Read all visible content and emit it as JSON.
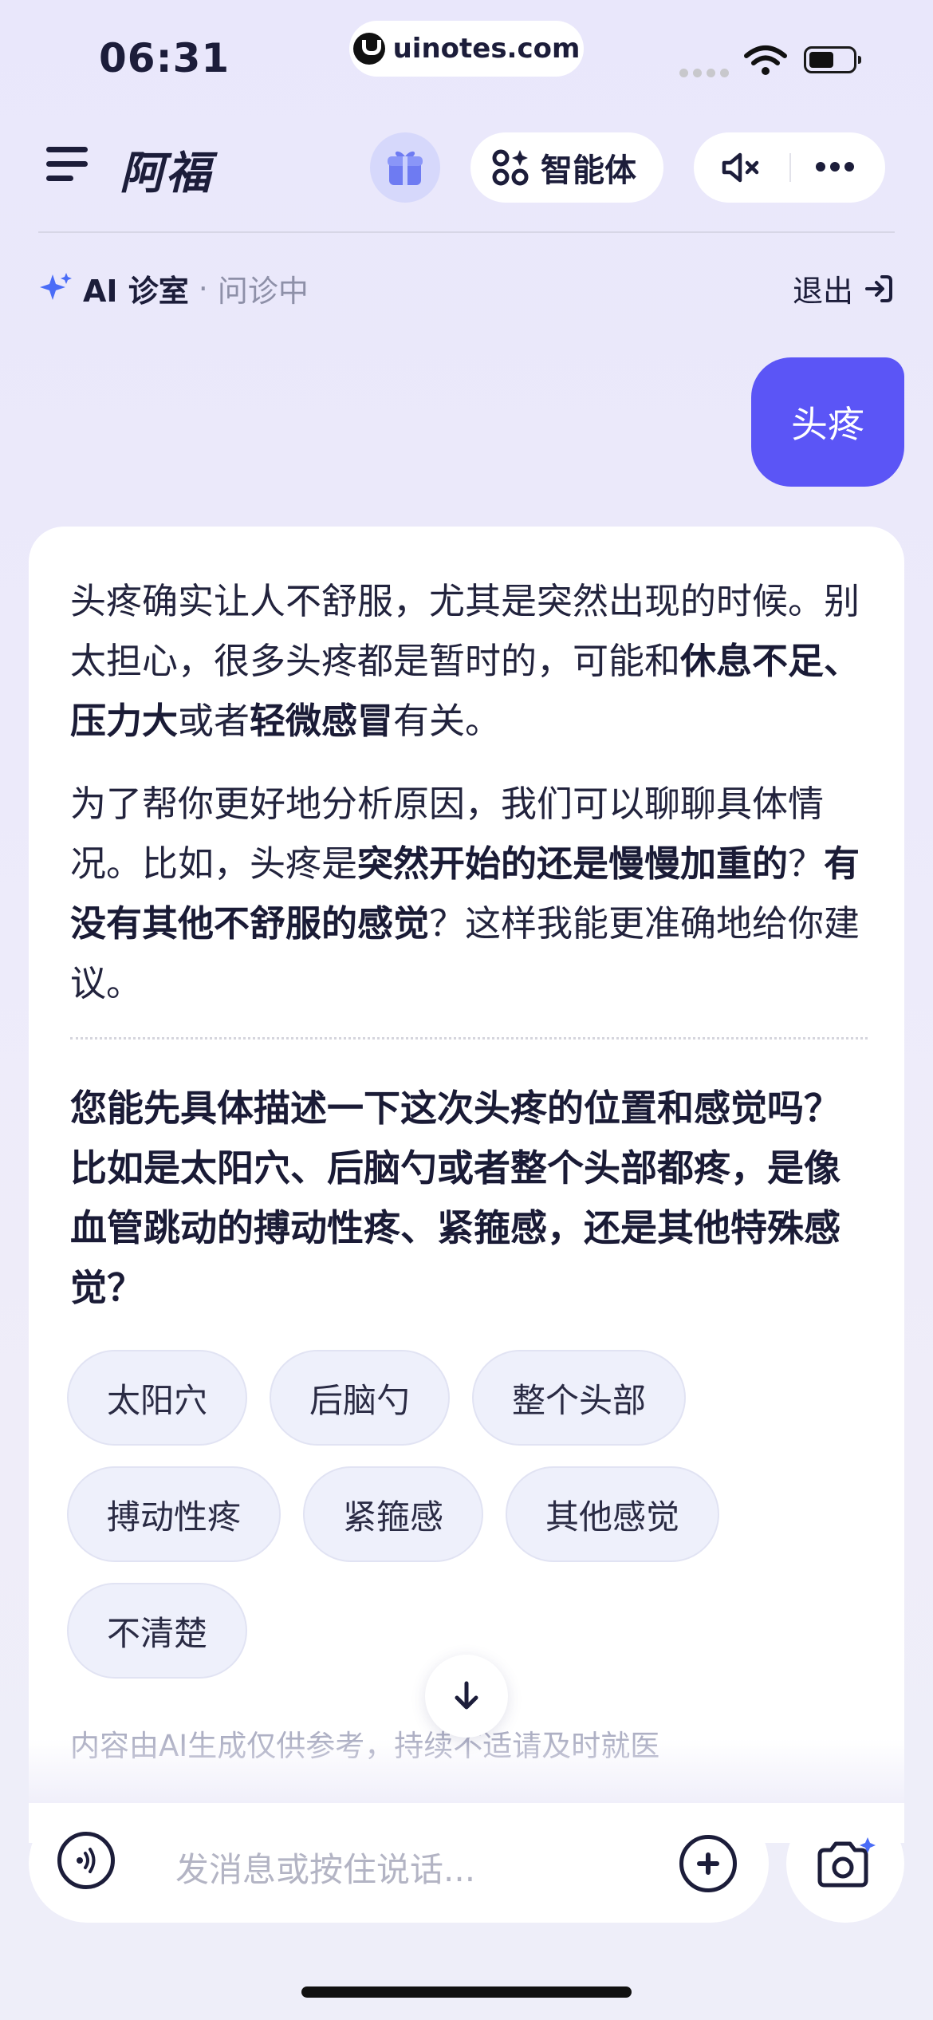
{
  "status_bar": {
    "time": "06:31",
    "url": "uinotes.com"
  },
  "header": {
    "title": "阿福",
    "agent_label": "智能体"
  },
  "clinic": {
    "name": "AI 诊室",
    "dot": "·",
    "status": "问诊中",
    "exit_label": "退出"
  },
  "chat": {
    "user_message": "头疼",
    "answer_p1_a": "头疼确实让人不舒服，尤其是突然出现的时候。别太担心，很多头疼都是暂时的，可能和",
    "answer_p1_b1": "休息不足",
    "answer_p1_c": "、",
    "answer_p1_b2": "压力大",
    "answer_p1_d": "或者",
    "answer_p1_b3": "轻微感冒",
    "answer_p1_e": "有关。",
    "answer_p2_a": "为了帮你更好地分析原因，我们可以聊聊具体情况。比如，头疼是",
    "answer_p2_b1": "突然开始的还是慢慢加重的",
    "answer_p2_c": "？",
    "answer_p2_b2": "有没有其他不舒服的感觉",
    "answer_p2_d": "？这样我能更准确地给你建议。",
    "question": "您能先具体描述一下这次头疼的位置和感觉吗？比如是太阳穴、后脑勺或者整个头部都疼，是像血管跳动的搏动性疼、紧箍感，还是其他特殊感觉？",
    "options": [
      "太阳穴",
      "后脑勺",
      "整个头部",
      "搏动性疼",
      "紧箍感",
      "其他感觉",
      "不清楚"
    ],
    "disclaimer": "内容由AI生成仅供参考，持续不适请及时就医"
  },
  "input": {
    "placeholder": "发消息或按住说话..."
  },
  "colors": {
    "accent": "#5b55f6",
    "sparkle": "#4a6cf7"
  },
  "icons": [
    "menu-icon",
    "gift-icon",
    "agent-icon",
    "mute-icon",
    "more-icon",
    "sparkle-icon",
    "exit-icon",
    "arrow-down-icon",
    "voice-icon",
    "plus-icon",
    "camera-icon"
  ]
}
